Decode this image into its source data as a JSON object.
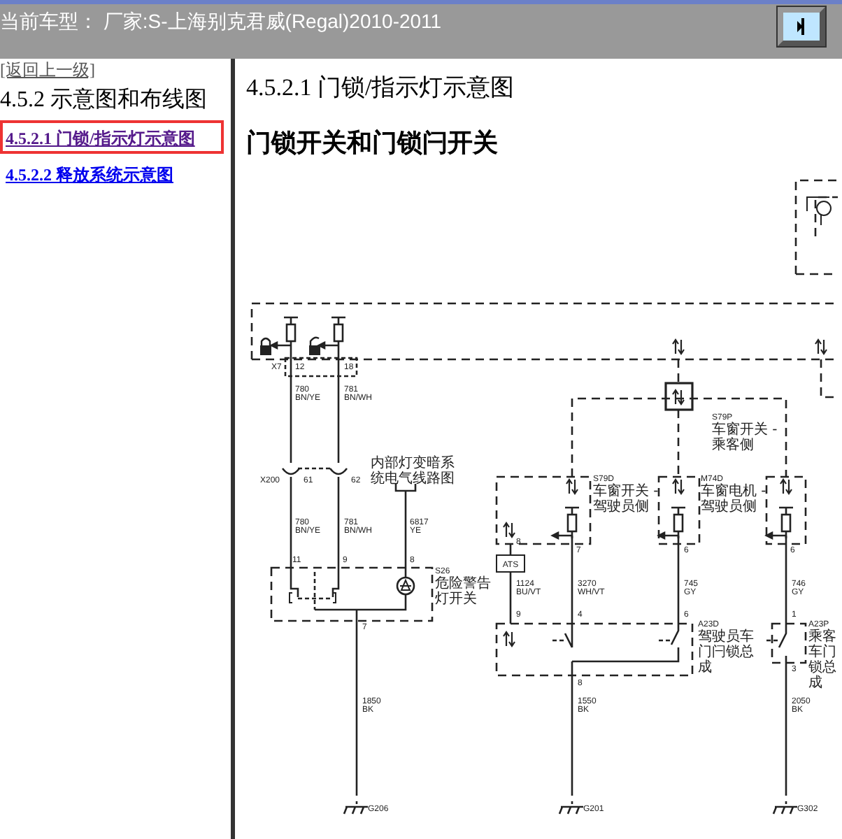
{
  "header": {
    "title": "当前车型： 厂家:S-上海别克君威(Regal)2010-2011"
  },
  "sidebar": {
    "back_link": "[返回上一级]",
    "section_title": "4.5.2 示意图和布线图",
    "items": [
      {
        "label": "4.5.2.1 门锁/指示灯示意图",
        "visited": true,
        "highlighted": true
      },
      {
        "label": "4.5.2.2 释放系统示意图",
        "visited": false,
        "highlighted": false
      }
    ]
  },
  "content": {
    "title": "4.5.2.1 门锁/指示灯示意图",
    "subtitle": "门锁开关和门锁闩开关",
    "diagram": {
      "labels": [
        {
          "kind": "wire",
          "lines": [
            "X7"
          ]
        },
        {
          "kind": "wire",
          "lines": [
            "12"
          ]
        },
        {
          "kind": "wire",
          "lines": [
            "18"
          ]
        },
        {
          "kind": "wire",
          "lines": [
            "780",
            "BN/YE"
          ]
        },
        {
          "kind": "wire",
          "lines": [
            "781",
            "BN/WH"
          ]
        },
        {
          "kind": "wire",
          "lines": [
            "X200"
          ]
        },
        {
          "kind": "wire",
          "lines": [
            "61"
          ]
        },
        {
          "kind": "wire",
          "lines": [
            "62"
          ]
        },
        {
          "kind": "note",
          "lines": [
            "内部灯变暗系",
            "统电气线路图"
          ]
        },
        {
          "kind": "wire",
          "lines": [
            "780",
            "BN/YE"
          ]
        },
        {
          "kind": "wire",
          "lines": [
            "781",
            "BN/WH"
          ]
        },
        {
          "kind": "wire",
          "lines": [
            "6817",
            "YE"
          ]
        },
        {
          "kind": "wire",
          "lines": [
            "11"
          ]
        },
        {
          "kind": "wire",
          "lines": [
            "9"
          ]
        },
        {
          "kind": "wire",
          "lines": [
            "8"
          ]
        },
        {
          "kind": "component",
          "code": "S26",
          "lines": [
            "危险警告",
            "灯开关"
          ]
        },
        {
          "kind": "wire",
          "lines": [
            "7"
          ]
        },
        {
          "kind": "wire",
          "lines": [
            "1850",
            "BK"
          ]
        },
        {
          "kind": "wire",
          "lines": [
            "G206"
          ]
        },
        {
          "kind": "tag",
          "lines": [
            "ATS"
          ]
        },
        {
          "kind": "wire",
          "lines": [
            "8"
          ]
        },
        {
          "kind": "wire",
          "lines": [
            "1124",
            "BU/VT"
          ]
        },
        {
          "kind": "wire",
          "lines": [
            "9"
          ]
        },
        {
          "kind": "component",
          "code": "S79P",
          "lines": [
            "车窗开关 -",
            "乘客侧"
          ]
        },
        {
          "kind": "component",
          "code": "S79D",
          "lines": [
            "车窗开关 -",
            "驾驶员侧"
          ]
        },
        {
          "kind": "component",
          "code": "M74D",
          "lines": [
            "车窗电机 -",
            "驾驶员侧"
          ]
        },
        {
          "kind": "wire",
          "lines": [
            "7"
          ]
        },
        {
          "kind": "wire",
          "lines": [
            "3270",
            "WH/VT"
          ]
        },
        {
          "kind": "wire",
          "lines": [
            "4"
          ]
        },
        {
          "kind": "wire",
          "lines": [
            "6"
          ]
        },
        {
          "kind": "wire",
          "lines": [
            "745",
            "GY"
          ]
        },
        {
          "kind": "wire",
          "lines": [
            "6"
          ]
        },
        {
          "kind": "wire",
          "lines": [
            "6"
          ]
        },
        {
          "kind": "wire",
          "lines": [
            "746",
            "GY"
          ]
        },
        {
          "kind": "wire",
          "lines": [
            "1"
          ]
        },
        {
          "kind": "component",
          "code": "A23D",
          "lines": [
            "驾驶员车",
            "门闩锁总",
            "成"
          ]
        },
        {
          "kind": "wire",
          "lines": [
            "8"
          ]
        },
        {
          "kind": "wire",
          "lines": [
            "3"
          ]
        },
        {
          "kind": "component",
          "code": "A23P",
          "lines": [
            "乘客",
            "车门",
            "锁总",
            "成"
          ]
        },
        {
          "kind": "wire",
          "lines": [
            "1550",
            "BK"
          ]
        },
        {
          "kind": "wire",
          "lines": [
            "2050",
            "BK"
          ]
        },
        {
          "kind": "wire",
          "lines": [
            "G201"
          ]
        },
        {
          "kind": "wire",
          "lines": [
            "G302"
          ]
        }
      ]
    }
  }
}
